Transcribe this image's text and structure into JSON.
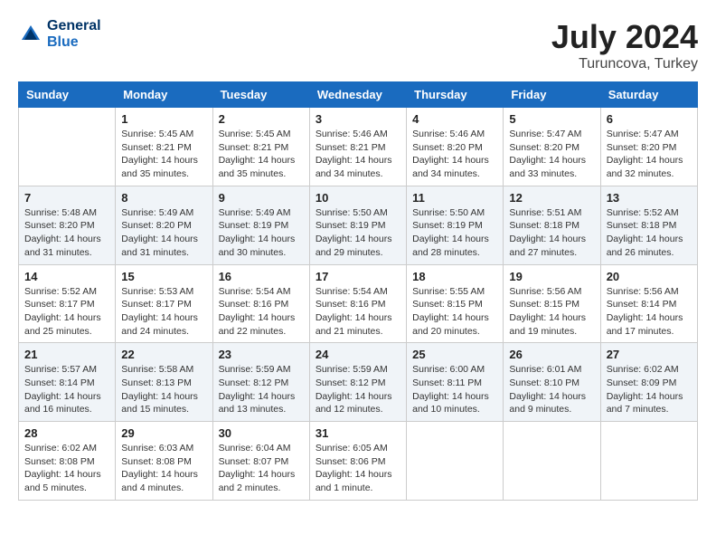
{
  "header": {
    "logo_line1": "General",
    "logo_line2": "Blue",
    "month_year": "July 2024",
    "location": "Turuncova, Turkey"
  },
  "weekdays": [
    "Sunday",
    "Monday",
    "Tuesday",
    "Wednesday",
    "Thursday",
    "Friday",
    "Saturday"
  ],
  "weeks": [
    [
      {
        "day": "",
        "info": ""
      },
      {
        "day": "1",
        "info": "Sunrise: 5:45 AM\nSunset: 8:21 PM\nDaylight: 14 hours\nand 35 minutes."
      },
      {
        "day": "2",
        "info": "Sunrise: 5:45 AM\nSunset: 8:21 PM\nDaylight: 14 hours\nand 35 minutes."
      },
      {
        "day": "3",
        "info": "Sunrise: 5:46 AM\nSunset: 8:21 PM\nDaylight: 14 hours\nand 34 minutes."
      },
      {
        "day": "4",
        "info": "Sunrise: 5:46 AM\nSunset: 8:20 PM\nDaylight: 14 hours\nand 34 minutes."
      },
      {
        "day": "5",
        "info": "Sunrise: 5:47 AM\nSunset: 8:20 PM\nDaylight: 14 hours\nand 33 minutes."
      },
      {
        "day": "6",
        "info": "Sunrise: 5:47 AM\nSunset: 8:20 PM\nDaylight: 14 hours\nand 32 minutes."
      }
    ],
    [
      {
        "day": "7",
        "info": "Sunrise: 5:48 AM\nSunset: 8:20 PM\nDaylight: 14 hours\nand 31 minutes."
      },
      {
        "day": "8",
        "info": "Sunrise: 5:49 AM\nSunset: 8:20 PM\nDaylight: 14 hours\nand 31 minutes."
      },
      {
        "day": "9",
        "info": "Sunrise: 5:49 AM\nSunset: 8:19 PM\nDaylight: 14 hours\nand 30 minutes."
      },
      {
        "day": "10",
        "info": "Sunrise: 5:50 AM\nSunset: 8:19 PM\nDaylight: 14 hours\nand 29 minutes."
      },
      {
        "day": "11",
        "info": "Sunrise: 5:50 AM\nSunset: 8:19 PM\nDaylight: 14 hours\nand 28 minutes."
      },
      {
        "day": "12",
        "info": "Sunrise: 5:51 AM\nSunset: 8:18 PM\nDaylight: 14 hours\nand 27 minutes."
      },
      {
        "day": "13",
        "info": "Sunrise: 5:52 AM\nSunset: 8:18 PM\nDaylight: 14 hours\nand 26 minutes."
      }
    ],
    [
      {
        "day": "14",
        "info": "Sunrise: 5:52 AM\nSunset: 8:17 PM\nDaylight: 14 hours\nand 25 minutes."
      },
      {
        "day": "15",
        "info": "Sunrise: 5:53 AM\nSunset: 8:17 PM\nDaylight: 14 hours\nand 24 minutes."
      },
      {
        "day": "16",
        "info": "Sunrise: 5:54 AM\nSunset: 8:16 PM\nDaylight: 14 hours\nand 22 minutes."
      },
      {
        "day": "17",
        "info": "Sunrise: 5:54 AM\nSunset: 8:16 PM\nDaylight: 14 hours\nand 21 minutes."
      },
      {
        "day": "18",
        "info": "Sunrise: 5:55 AM\nSunset: 8:15 PM\nDaylight: 14 hours\nand 20 minutes."
      },
      {
        "day": "19",
        "info": "Sunrise: 5:56 AM\nSunset: 8:15 PM\nDaylight: 14 hours\nand 19 minutes."
      },
      {
        "day": "20",
        "info": "Sunrise: 5:56 AM\nSunset: 8:14 PM\nDaylight: 14 hours\nand 17 minutes."
      }
    ],
    [
      {
        "day": "21",
        "info": "Sunrise: 5:57 AM\nSunset: 8:14 PM\nDaylight: 14 hours\nand 16 minutes."
      },
      {
        "day": "22",
        "info": "Sunrise: 5:58 AM\nSunset: 8:13 PM\nDaylight: 14 hours\nand 15 minutes."
      },
      {
        "day": "23",
        "info": "Sunrise: 5:59 AM\nSunset: 8:12 PM\nDaylight: 14 hours\nand 13 minutes."
      },
      {
        "day": "24",
        "info": "Sunrise: 5:59 AM\nSunset: 8:12 PM\nDaylight: 14 hours\nand 12 minutes."
      },
      {
        "day": "25",
        "info": "Sunrise: 6:00 AM\nSunset: 8:11 PM\nDaylight: 14 hours\nand 10 minutes."
      },
      {
        "day": "26",
        "info": "Sunrise: 6:01 AM\nSunset: 8:10 PM\nDaylight: 14 hours\nand 9 minutes."
      },
      {
        "day": "27",
        "info": "Sunrise: 6:02 AM\nSunset: 8:09 PM\nDaylight: 14 hours\nand 7 minutes."
      }
    ],
    [
      {
        "day": "28",
        "info": "Sunrise: 6:02 AM\nSunset: 8:08 PM\nDaylight: 14 hours\nand 5 minutes."
      },
      {
        "day": "29",
        "info": "Sunrise: 6:03 AM\nSunset: 8:08 PM\nDaylight: 14 hours\nand 4 minutes."
      },
      {
        "day": "30",
        "info": "Sunrise: 6:04 AM\nSunset: 8:07 PM\nDaylight: 14 hours\nand 2 minutes."
      },
      {
        "day": "31",
        "info": "Sunrise: 6:05 AM\nSunset: 8:06 PM\nDaylight: 14 hours\nand 1 minute."
      },
      {
        "day": "",
        "info": ""
      },
      {
        "day": "",
        "info": ""
      },
      {
        "day": "",
        "info": ""
      }
    ]
  ]
}
